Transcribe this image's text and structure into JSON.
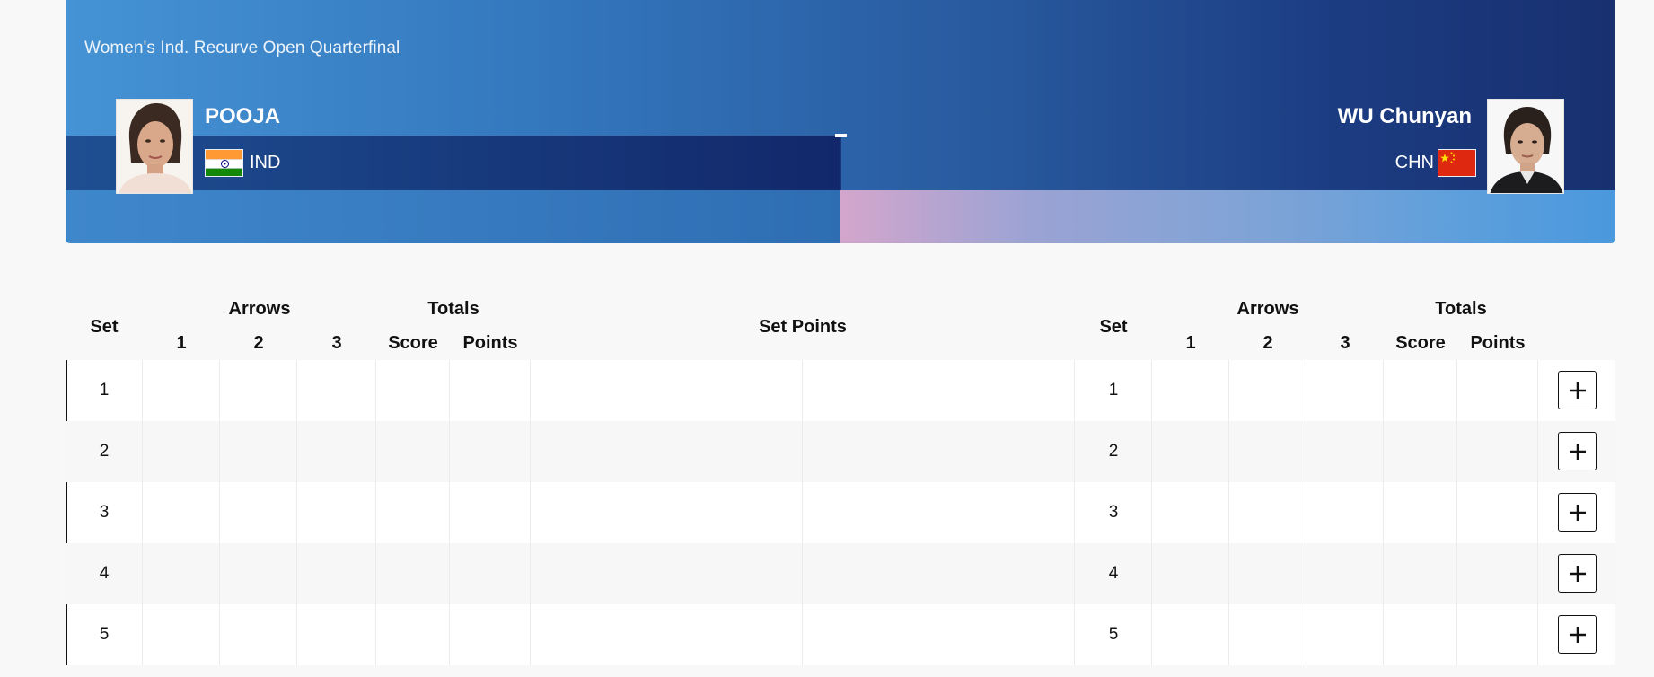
{
  "event": {
    "title": "Women's Ind. Recurve Open Quarterfinal"
  },
  "athletes": {
    "left": {
      "name": "POOJA",
      "noc": "IND",
      "flag_icon": "india-flag-icon"
    },
    "right": {
      "name": "WU Chunyan",
      "noc": "CHN",
      "flag_icon": "china-flag-icon"
    }
  },
  "score_separator": "-",
  "table": {
    "headers": {
      "set": "Set",
      "arrows": "Arrows",
      "totals": "Totals",
      "arrow_1": "1",
      "arrow_2": "2",
      "arrow_3": "3",
      "score": "Score",
      "points": "Points",
      "set_points": "Set Points"
    },
    "rows": [
      {
        "set": "1"
      },
      {
        "set": "2"
      },
      {
        "set": "3"
      },
      {
        "set": "4"
      },
      {
        "set": "5"
      }
    ],
    "expand_icon": "plus-icon"
  },
  "colors": {
    "banner_light": "#4593d4",
    "banner_dark": "#18306f",
    "band_dark": "#12286a",
    "pink_accent": "#d3a6cc"
  }
}
